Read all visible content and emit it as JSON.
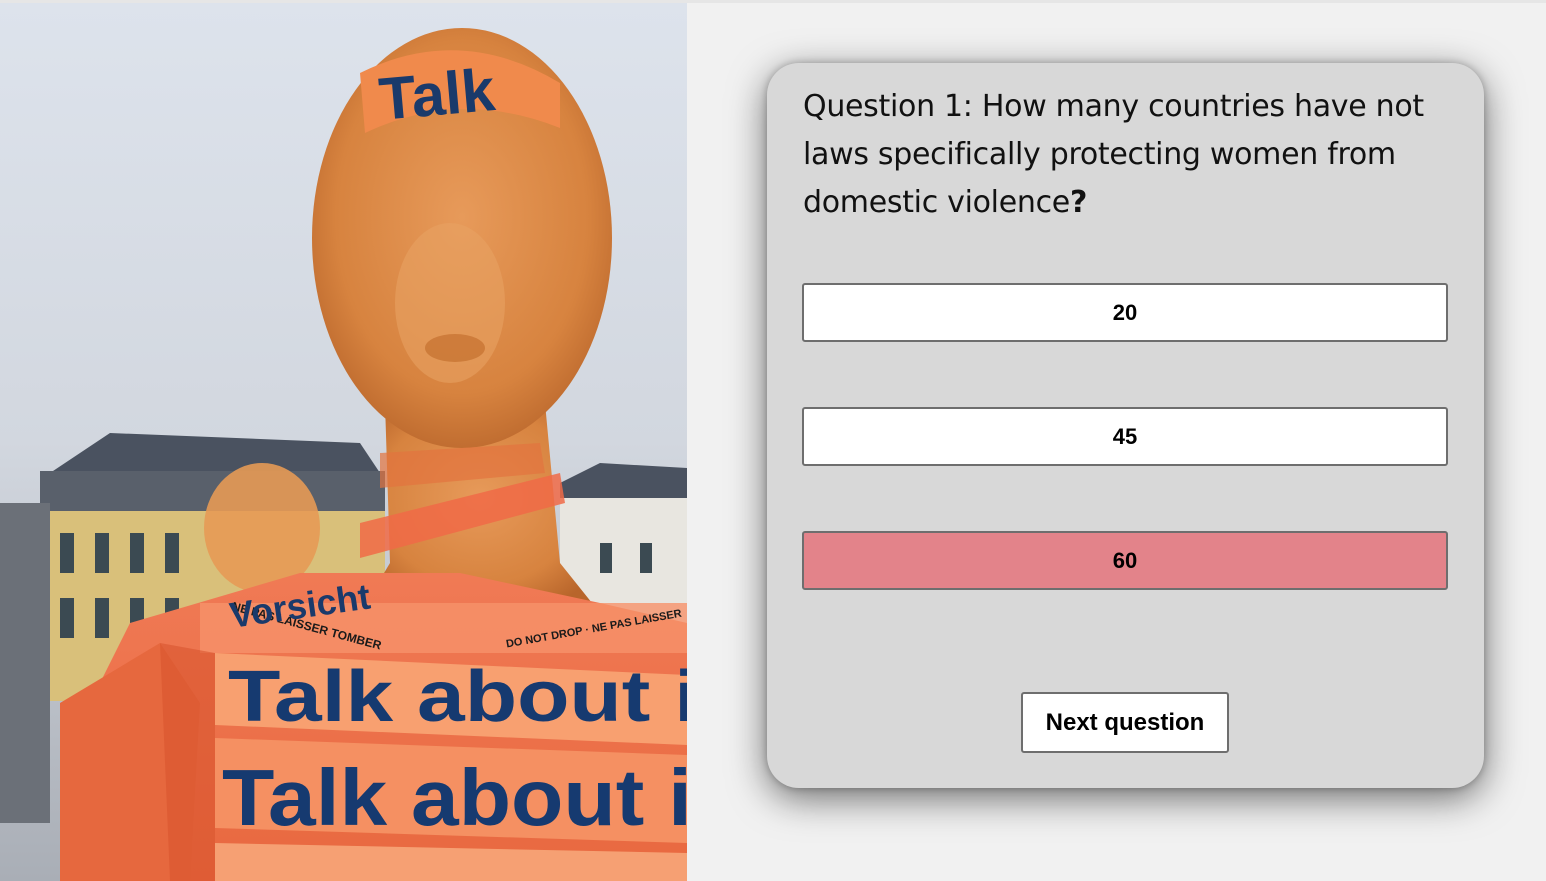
{
  "photo": {
    "tape_texts": [
      "Talk",
      "Talk about i",
      "Talk about i",
      "Vorsicht",
      "NE PAS LAISSER TOMBER",
      "DO NOT DROP · NE PAS LAISSER"
    ]
  },
  "quiz": {
    "question_prefix": "Question 1:",
    "question_text": "How many countries have not laws specifically protecting women from domestic violence",
    "question_mark": "?",
    "answers": [
      {
        "label": "20"
      },
      {
        "label": "45"
      },
      {
        "label": "60"
      }
    ],
    "selected_answer_color": "#e3838a",
    "next_label": "Next question"
  }
}
